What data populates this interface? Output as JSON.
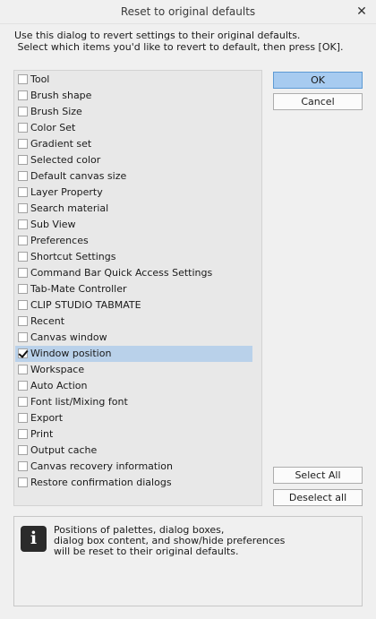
{
  "window": {
    "title": "Reset to original defaults",
    "close_glyph": "✕"
  },
  "description": {
    "line1": "Use this dialog to revert settings to their original defaults.",
    "line2": " Select which items you'd like to revert to default, then press [OK]."
  },
  "items": [
    {
      "label": "Tool",
      "checked": false
    },
    {
      "label": "Brush shape",
      "checked": false
    },
    {
      "label": "Brush Size",
      "checked": false
    },
    {
      "label": "Color Set",
      "checked": false
    },
    {
      "label": "Gradient set",
      "checked": false
    },
    {
      "label": "Selected color",
      "checked": false
    },
    {
      "label": "Default canvas size",
      "checked": false
    },
    {
      "label": "Layer Property",
      "checked": false
    },
    {
      "label": "Search material",
      "checked": false
    },
    {
      "label": "Sub View",
      "checked": false
    },
    {
      "label": "Preferences",
      "checked": false
    },
    {
      "label": "Shortcut Settings",
      "checked": false
    },
    {
      "label": "Command Bar Quick Access Settings",
      "checked": false
    },
    {
      "label": "Tab-Mate Controller",
      "checked": false
    },
    {
      "label": "CLIP STUDIO TABMATE",
      "checked": false
    },
    {
      "label": "Recent",
      "checked": false
    },
    {
      "label": "Canvas window",
      "checked": false
    },
    {
      "label": "Window position",
      "checked": true,
      "selected": true
    },
    {
      "label": "Workspace",
      "checked": false
    },
    {
      "label": "Auto Action",
      "checked": false
    },
    {
      "label": "Font list/Mixing font",
      "checked": false
    },
    {
      "label": "Export",
      "checked": false
    },
    {
      "label": "Print",
      "checked": false
    },
    {
      "label": "Output cache",
      "checked": false
    },
    {
      "label": "Canvas recovery information",
      "checked": false
    },
    {
      "label": "Restore confirmation dialogs",
      "checked": false
    }
  ],
  "buttons": {
    "ok": "OK",
    "cancel": "Cancel",
    "select_all": "Select All",
    "deselect_all": "Deselect all"
  },
  "info": {
    "icon": "info-icon",
    "icon_glyph": "i",
    "line1": "Positions of palettes, dialog boxes,",
    "line2": "dialog box content, and show/hide preferences",
    "line3": "will be reset to their original defaults."
  }
}
